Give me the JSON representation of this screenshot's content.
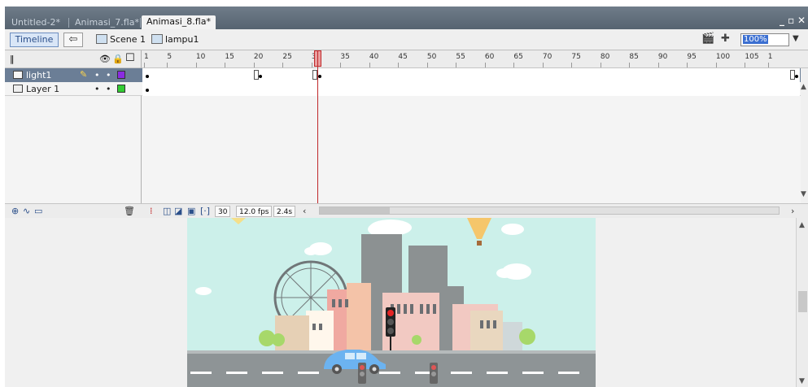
{
  "tabs": [
    {
      "label": "Untitled-2*"
    },
    {
      "label": "Animasi_7.fla*"
    },
    {
      "label": "Animasi_8.fla*"
    }
  ],
  "window_controls": {
    "restore": "– ̆",
    "close": "×"
  },
  "scene_bar": {
    "timeline_button": "Timeline",
    "scene_label": "Scene 1",
    "symbol_label": "lampu1",
    "zoom_value": "100%"
  },
  "ruler": {
    "ticks": [
      "1",
      "5",
      "10",
      "15",
      "20",
      "25",
      "30",
      "35",
      "40",
      "45",
      "50",
      "55",
      "60",
      "65",
      "70",
      "75",
      "80",
      "85",
      "90",
      "95",
      "100",
      "105",
      "1"
    ],
    "current_frame": 30
  },
  "layers": [
    {
      "name": "light1",
      "selected": true,
      "color": "#8a2be2"
    },
    {
      "name": "Layer 1",
      "selected": false,
      "color": "#33cc33"
    }
  ],
  "footer": {
    "frame_number": "30",
    "fps": "12.0 fps",
    "time": "2.4s"
  },
  "colors": {
    "accent": "#3b6fd1",
    "playhead": "#c0282a",
    "sky": "#ccf0ea",
    "road": "#8e9496"
  },
  "icons": [
    "eye-icon",
    "lock-icon",
    "outline-icon",
    "pencil-icon",
    "trash-icon",
    "add-layer-icon",
    "add-folder-icon",
    "onion-skin-icon"
  ]
}
